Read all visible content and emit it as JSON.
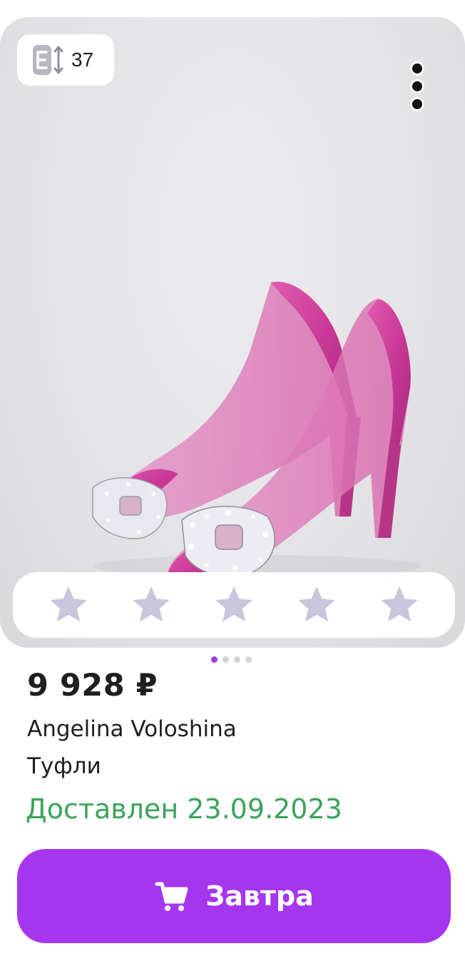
{
  "card": {
    "size_badge": {
      "icon": "size-range-icon",
      "count": "37"
    },
    "more_icon": "more-vertical-icon",
    "image": {
      "subject": "pink heeled shoes with crystal buckle",
      "pager": {
        "total": 4,
        "active": 1
      }
    },
    "rating": {
      "stars": 5,
      "filled": 0,
      "star_color": "#c9c5dc"
    }
  },
  "product": {
    "price": "9 928 ₽",
    "brand": "Angelina Voloshina",
    "type": "Туфли",
    "status": "Доставлен 23.09.2023"
  },
  "action": {
    "icon": "cart-icon",
    "label": "Завтра"
  },
  "colors": {
    "accent": "#a636ee",
    "status_green": "#3aa35c",
    "pager_active": "#9b3ee6"
  }
}
